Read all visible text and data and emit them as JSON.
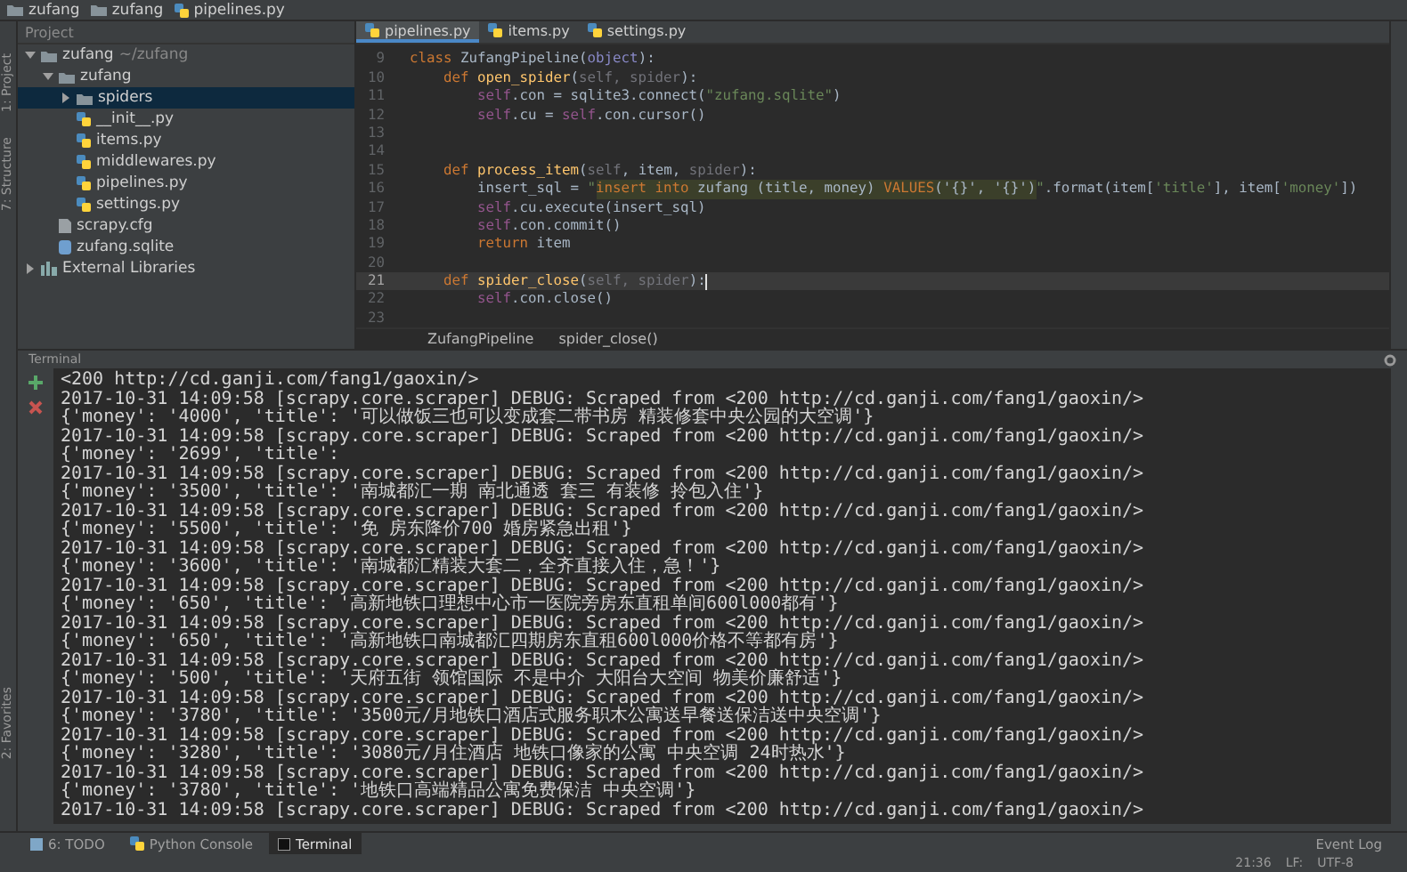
{
  "navbar": {
    "crumbs": [
      {
        "label": "zufang",
        "kind": "folder"
      },
      {
        "label": "zufang",
        "kind": "folder"
      },
      {
        "label": "pipelines.py",
        "kind": "py"
      }
    ]
  },
  "left_strip": {
    "labels": [
      "1: Project",
      "7: Structure",
      "2: Favorites"
    ]
  },
  "project": {
    "title": "Project",
    "tree": [
      {
        "label": "zufang",
        "hint": "~/zufang",
        "kind": "folder",
        "expanded": true,
        "selected": false,
        "children": [
          {
            "label": "zufang",
            "kind": "folder",
            "expanded": true,
            "selected": false,
            "children": [
              {
                "label": "spiders",
                "kind": "folder",
                "expanded": false,
                "selected": true
              },
              {
                "label": "__init__.py",
                "kind": "py",
                "selected": false
              },
              {
                "label": "items.py",
                "kind": "py",
                "selected": false
              },
              {
                "label": "middlewares.py",
                "kind": "py",
                "selected": false
              },
              {
                "label": "pipelines.py",
                "kind": "py",
                "selected": false
              },
              {
                "label": "settings.py",
                "kind": "py",
                "selected": false
              }
            ]
          },
          {
            "label": "scrapy.cfg",
            "kind": "cfg",
            "selected": false
          },
          {
            "label": "zufang.sqlite",
            "kind": "db",
            "selected": false
          }
        ]
      },
      {
        "label": "External Libraries",
        "kind": "lib",
        "expanded": false,
        "selected": false
      }
    ]
  },
  "editor": {
    "tabs": [
      {
        "label": "pipelines.py",
        "selected": true
      },
      {
        "label": "items.py",
        "selected": false
      },
      {
        "label": "settings.py",
        "selected": false
      }
    ],
    "lines": [
      {
        "number": "9",
        "current": false,
        "tokens": [
          {
            "text": "class ",
            "kind": "kw"
          },
          {
            "text": "ZufangPipeline",
            "kind": "plain"
          },
          {
            "text": "(",
            "kind": "plain"
          },
          {
            "text": "object",
            "kind": "builtin"
          },
          {
            "text": "):",
            "kind": "plain"
          }
        ]
      },
      {
        "number": "10",
        "current": false,
        "tokens": [
          {
            "text": "    def ",
            "kind": "kw"
          },
          {
            "text": "open_spider",
            "kind": "fn"
          },
          {
            "text": "(",
            "kind": "plain"
          },
          {
            "text": "self, spider",
            "kind": "param"
          },
          {
            "text": "):",
            "kind": "plain"
          }
        ]
      },
      {
        "number": "11",
        "current": false,
        "tokens": [
          {
            "text": "        self",
            "kind": "self"
          },
          {
            "text": ".con = sqlite3.connect(",
            "kind": "plain"
          },
          {
            "text": "\"zufang.sqlite\"",
            "kind": "str"
          },
          {
            "text": ")",
            "kind": "plain"
          }
        ]
      },
      {
        "number": "12",
        "current": false,
        "tokens": [
          {
            "text": "        self",
            "kind": "self"
          },
          {
            "text": ".cu = ",
            "kind": "plain"
          },
          {
            "text": "self",
            "kind": "self"
          },
          {
            "text": ".con.cursor()",
            "kind": "plain"
          }
        ]
      },
      {
        "number": "13",
        "current": false
      },
      {
        "number": "14",
        "current": false
      },
      {
        "number": "15",
        "current": false,
        "tokens": [
          {
            "text": "    def ",
            "kind": "kw"
          },
          {
            "text": "process_item",
            "kind": "fn"
          },
          {
            "text": "(",
            "kind": "plain"
          },
          {
            "text": "self",
            "kind": "param"
          },
          {
            "text": ", item, ",
            "kind": "plain"
          },
          {
            "text": "spider",
            "kind": "param"
          },
          {
            "text": "):",
            "kind": "plain"
          }
        ]
      },
      {
        "number": "16",
        "current": false,
        "tokens": [
          {
            "text": "        insert_sql = ",
            "kind": "plain"
          },
          {
            "text": "\"",
            "kind": "str"
          },
          {
            "text": "insert into",
            "kind": "sqlkw"
          },
          {
            "text": " zufang (title, money) ",
            "kind": "sql"
          },
          {
            "text": "VALUES",
            "kind": "sqlkw"
          },
          {
            "text": "('{}', '{}')",
            "kind": "sql"
          },
          {
            "text": "\"",
            "kind": "str"
          },
          {
            "text": ".format(item[",
            "kind": "plain"
          },
          {
            "text": "'title'",
            "kind": "str"
          },
          {
            "text": "], item[",
            "kind": "plain"
          },
          {
            "text": "'money'",
            "kind": "str"
          },
          {
            "text": "])",
            "kind": "plain"
          }
        ]
      },
      {
        "number": "17",
        "current": false,
        "tokens": [
          {
            "text": "        self",
            "kind": "self"
          },
          {
            "text": ".cu.execute(insert_sql)",
            "kind": "plain"
          }
        ]
      },
      {
        "number": "18",
        "current": false,
        "tokens": [
          {
            "text": "        self",
            "kind": "self"
          },
          {
            "text": ".con.commit()",
            "kind": "plain"
          }
        ]
      },
      {
        "number": "19",
        "current": false,
        "tokens": [
          {
            "text": "        return ",
            "kind": "kw"
          },
          {
            "text": "item",
            "kind": "plain"
          }
        ]
      },
      {
        "number": "20",
        "current": false
      },
      {
        "number": "21",
        "current": true,
        "tokens": [
          {
            "text": "    def ",
            "kind": "kw"
          },
          {
            "text": "spider_close",
            "kind": "fn"
          },
          {
            "text": "(",
            "kind": "plain"
          },
          {
            "text": "self, spider",
            "kind": "param"
          },
          {
            "text": "):",
            "kind": "plain"
          }
        ]
      },
      {
        "number": "22",
        "current": false,
        "tokens": [
          {
            "text": "        self",
            "kind": "self"
          },
          {
            "text": ".con.close()",
            "kind": "plain"
          }
        ]
      },
      {
        "number": "23",
        "current": false
      }
    ],
    "breadcrumb": [
      "ZufangPipeline",
      "spider_close()"
    ]
  },
  "terminal": {
    "title": "Terminal",
    "lines": [
      "<200 http://cd.ganji.com/fang1/gaoxin/>",
      "2017-10-31 14:09:58 [scrapy.core.scraper] DEBUG: Scraped from <200 http://cd.ganji.com/fang1/gaoxin/>",
      "{'money': '4000', 'title': '可以做饭三也可以变成套二带书房 精装修套中央公园的大空调'}",
      "2017-10-31 14:09:58 [scrapy.core.scraper] DEBUG: Scraped from <200 http://cd.ganji.com/fang1/gaoxin/>",
      "{'money': '2699', 'title':",
      "2017-10-31 14:09:58 [scrapy.core.scraper] DEBUG: Scraped from <200 http://cd.ganji.com/fang1/gaoxin/>",
      "{'money': '3500', 'title': '南城都汇一期 南北通透 套三 有装修 拎包入住'}",
      "2017-10-31 14:09:58 [scrapy.core.scraper] DEBUG: Scraped from <200 http://cd.ganji.com/fang1/gaoxin/>",
      "{'money': '5500', 'title': '免 房东降价700 婚房紧急出租'}",
      "2017-10-31 14:09:58 [scrapy.core.scraper] DEBUG: Scraped from <200 http://cd.ganji.com/fang1/gaoxin/>",
      "{'money': '3600', 'title': '南城都汇精装大套二，全齐直接入住，急！'}",
      "2017-10-31 14:09:58 [scrapy.core.scraper] DEBUG: Scraped from <200 http://cd.ganji.com/fang1/gaoxin/>",
      "{'money': '650', 'title': '高新地铁口理想中心市一医院旁房东直租单间600l000都有'}",
      "2017-10-31 14:09:58 [scrapy.core.scraper] DEBUG: Scraped from <200 http://cd.ganji.com/fang1/gaoxin/>",
      "{'money': '650', 'title': '高新地铁口南城都汇四期房东直租600l000价格不等都有房'}",
      "2017-10-31 14:09:58 [scrapy.core.scraper] DEBUG: Scraped from <200 http://cd.ganji.com/fang1/gaoxin/>",
      "{'money': '500', 'title': '天府五街 领馆国际 不是中介 大阳台大空间 物美价廉舒适'}",
      "2017-10-31 14:09:58 [scrapy.core.scraper] DEBUG: Scraped from <200 http://cd.ganji.com/fang1/gaoxin/>",
      "{'money': '3780', 'title': '3500元/月地铁口酒店式服务职木公寓送早餐送保洁送中央空调'}",
      "2017-10-31 14:09:58 [scrapy.core.scraper] DEBUG: Scraped from <200 http://cd.ganji.com/fang1/gaoxin/>",
      "{'money': '3280', 'title': '3080元/月住酒店 地铁口像家的公寓 中央空调 24时热水'}",
      "2017-10-31 14:09:58 [scrapy.core.scraper] DEBUG: Scraped from <200 http://cd.ganji.com/fang1/gaoxin/>",
      "{'money': '3780', 'title': '地铁口高端精品公寓免费保洁 中央空调'}",
      "2017-10-31 14:09:58 [scrapy.core.scraper] DEBUG: Scraped from <200 http://cd.ganji.com/fang1/gaoxin/>"
    ]
  },
  "bottom_tabs": [
    {
      "label": "6: TODO",
      "kind": "todo",
      "selected": false
    },
    {
      "label": "Python Console",
      "kind": "console",
      "selected": false
    },
    {
      "label": "Terminal",
      "kind": "terminal",
      "selected": true
    }
  ],
  "event_log": "Event Log",
  "status_bar": [
    "21:36",
    "LF:",
    "UTF-8"
  ]
}
